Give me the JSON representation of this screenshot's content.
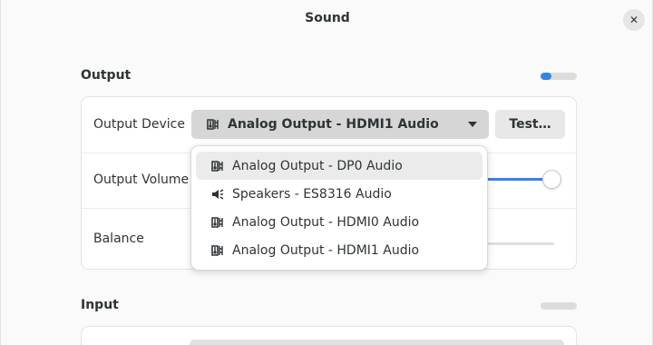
{
  "window": {
    "title": "Sound",
    "close_glyph": "✕"
  },
  "output": {
    "section_title": "Output",
    "level_fraction": 0.3,
    "device_row": {
      "label": "Output Device",
      "selected": "Analog Output - HDMI1 Audio",
      "icon": "audio-card-icon"
    },
    "test_button": "Test…",
    "volume_row": {
      "label": "Output Volume",
      "level_fraction": 1.0
    },
    "balance_row": {
      "label": "Balance"
    }
  },
  "device_menu": {
    "items": [
      {
        "label": "Analog Output - DP0 Audio",
        "icon": "audio-card-icon",
        "highlighted": true
      },
      {
        "label": "Speakers - ES8316 Audio",
        "icon": "speaker-icon",
        "highlighted": false
      },
      {
        "label": "Analog Output - HDMI0 Audio",
        "icon": "audio-card-icon",
        "highlighted": false
      },
      {
        "label": "Analog Output - HDMI1 Audio",
        "icon": "audio-card-icon",
        "highlighted": false
      }
    ]
  },
  "input": {
    "section_title": "Input",
    "level_fraction": 0.0
  },
  "colors": {
    "accent": "#3584e4",
    "background": "#fafafa",
    "card": "#ffffff",
    "text": "#2e3436"
  }
}
